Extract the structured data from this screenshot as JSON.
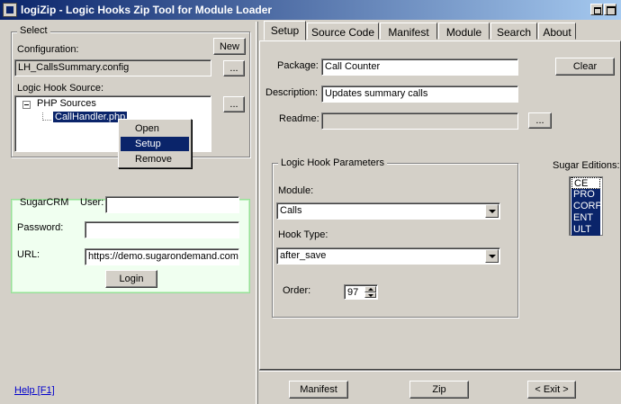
{
  "window": {
    "title": "logiZip - Logic Hooks Zip Tool for Module Loader"
  },
  "select_group": {
    "label": "Select",
    "configuration_label": "Configuration:",
    "new_button": "New",
    "configuration_value": "LH_CallsSummary.config",
    "browse_button": "...",
    "source_label": "Logic Hook Source:",
    "tree_root": "PHP Sources",
    "tree_child": "CallHandler.php",
    "source_browse_button": "..."
  },
  "context_menu": {
    "items": [
      "Open",
      "Setup",
      "Remove"
    ],
    "selected": "Setup"
  },
  "sugarcrm": {
    "label": "SugarCRM",
    "user_label": "User:",
    "user_value": "",
    "password_label": "Password:",
    "password_value": "",
    "url_label": "URL:",
    "url_value": "https://demo.sugarondemand.com",
    "login_button": "Login"
  },
  "tabs": [
    "Setup",
    "Source Code",
    "Manifest",
    "Module",
    "Search",
    "About"
  ],
  "active_tab": "Setup",
  "setup": {
    "package_label": "Package:",
    "package_value": "Call  Counter",
    "clear_button": "Clear",
    "description_label": "Description:",
    "description_value": "Updates summary calls",
    "readme_label": "Readme:",
    "readme_value": "",
    "readme_browse_button": "...",
    "params_label": "Logic Hook Parameters",
    "module_label": "Module:",
    "module_value": "Calls",
    "hook_type_label": "Hook Type:",
    "hook_type_value": "after_save",
    "order_label": "Order:",
    "order_value": "97",
    "editions_label": "Sugar Editions:",
    "editions": [
      "CE",
      "PRO",
      "CORP",
      "ENT",
      "ULT"
    ]
  },
  "footer": {
    "help_link": "Help [F1]",
    "manifest_button": "Manifest",
    "zip_button": "Zip",
    "exit_button": "< Exit >"
  }
}
